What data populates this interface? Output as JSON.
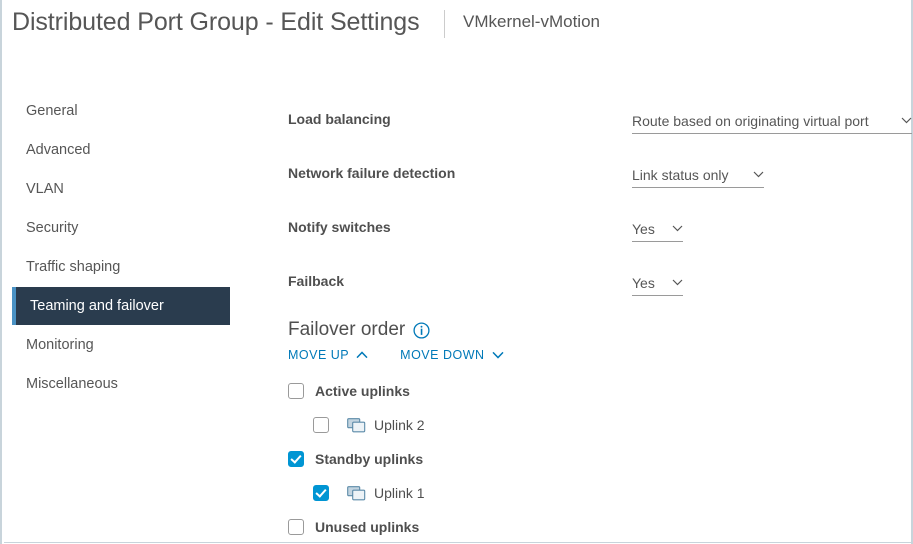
{
  "header": {
    "title": "Distributed Port Group - Edit Settings",
    "object_name": "VMkernel-vMotion"
  },
  "sidebar": {
    "items": [
      {
        "label": "General",
        "selected": false
      },
      {
        "label": "Advanced",
        "selected": false
      },
      {
        "label": "VLAN",
        "selected": false
      },
      {
        "label": "Security",
        "selected": false
      },
      {
        "label": "Traffic shaping",
        "selected": false
      },
      {
        "label": "Teaming and failover",
        "selected": true
      },
      {
        "label": "Monitoring",
        "selected": false
      },
      {
        "label": "Miscellaneous",
        "selected": false
      }
    ]
  },
  "form": {
    "load_balancing": {
      "label": "Load balancing",
      "value": "Route based on originating virtual port"
    },
    "network_failure_detection": {
      "label": "Network failure detection",
      "value": "Link status only"
    },
    "notify_switches": {
      "label": "Notify switches",
      "value": "Yes"
    },
    "failback": {
      "label": "Failback",
      "value": "Yes"
    }
  },
  "failover_order": {
    "title": "Failover order",
    "info_icon": "info-circle-icon",
    "move_up_label": "Move up",
    "move_down_label": "Move down",
    "rows": [
      {
        "label": "Active uplinks",
        "checked": false,
        "type": "group"
      },
      {
        "label": "Uplink 2",
        "checked": false,
        "type": "leaf",
        "icon": "uplink-icon"
      },
      {
        "label": "Standby uplinks",
        "checked": true,
        "type": "group"
      },
      {
        "label": "Uplink 1",
        "checked": true,
        "type": "leaf",
        "icon": "uplink-icon"
      },
      {
        "label": "Unused uplinks",
        "checked": false,
        "type": "group"
      }
    ]
  },
  "colors": {
    "accent_blue": "#0095d3",
    "link_blue": "#0079b8",
    "selected_nav_bg": "#2a3c4e",
    "selected_nav_accent": "#4a92c4",
    "label_gray": "#4f4f4f",
    "border_gray": "#c8d4db"
  }
}
